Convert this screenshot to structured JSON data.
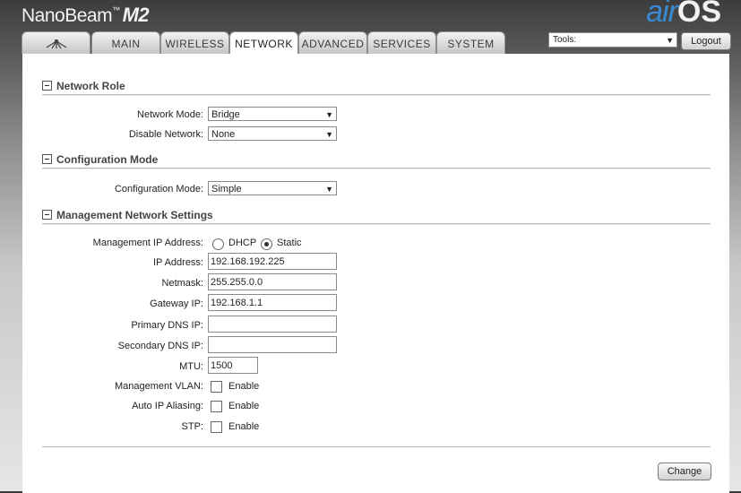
{
  "header": {
    "product": "NanoBeam",
    "tm": "™",
    "model": "M2",
    "logo_air": "air",
    "logo_os": "OS"
  },
  "tabs": [
    {
      "label": "",
      "icon": "ubiquiti-logo-icon"
    },
    {
      "label": "MAIN"
    },
    {
      "label": "WIRELESS"
    },
    {
      "label": "NETWORK",
      "active": true
    },
    {
      "label": "ADVANCED"
    },
    {
      "label": "SERVICES"
    },
    {
      "label": "SYSTEM"
    }
  ],
  "toolbar": {
    "tools_value": "Tools:",
    "logout_label": "Logout"
  },
  "network_role": {
    "title": "Network Role",
    "network_mode_label": "Network Mode:",
    "network_mode_value": "Bridge",
    "disable_network_label": "Disable Network:",
    "disable_network_value": "None"
  },
  "configuration_mode": {
    "title": "Configuration Mode",
    "label": "Configuration Mode:",
    "value": "Simple"
  },
  "management": {
    "title": "Management Network Settings",
    "ip_mode_label": "Management IP Address:",
    "dhcp_label": "DHCP",
    "static_label": "Static",
    "selected_mode": "Static",
    "ip_label": "IP Address:",
    "ip_value": "192.168.192.225",
    "netmask_label": "Netmask:",
    "netmask_value": "255.255.0.0",
    "gateway_label": "Gateway IP:",
    "gateway_value": "192.168.1.1",
    "primary_dns_label": "Primary DNS IP:",
    "primary_dns_value": "",
    "secondary_dns_label": "Secondary DNS IP:",
    "secondary_dns_value": "",
    "mtu_label": "MTU:",
    "mtu_value": "1500",
    "vlan_label": "Management VLAN:",
    "vlan_enable": "Enable",
    "auto_ip_label": "Auto IP Aliasing:",
    "auto_ip_enable": "Enable",
    "stp_label": "STP:",
    "stp_enable": "Enable"
  },
  "actions": {
    "change_label": "Change"
  }
}
